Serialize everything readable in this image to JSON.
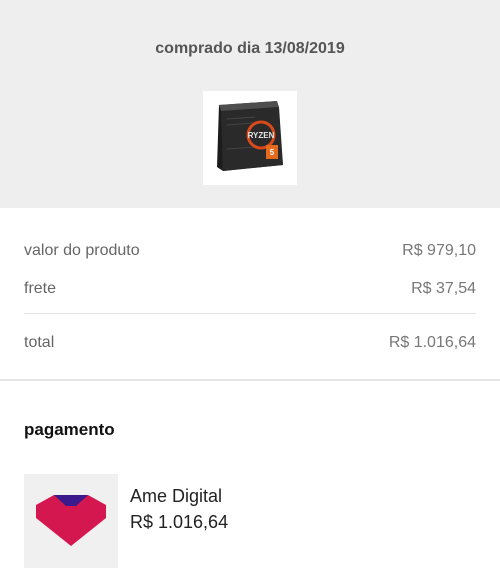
{
  "header": {
    "purchase_date": "comprado dia 13/08/2019"
  },
  "product": {
    "image_icon": "cpu-box-image",
    "brand_text": "RYZEN"
  },
  "summary": {
    "product_label": "valor do produto",
    "product_value": "R$ 979,10",
    "shipping_label": "frete",
    "shipping_value": "R$ 37,54",
    "total_label": "total",
    "total_value": "R$ 1.016,64"
  },
  "payment": {
    "title": "pagamento",
    "method_name": "Ame Digital",
    "method_amount": "R$ 1.016,64",
    "logo_icon": "ame-heart-logo",
    "logo_color": "#d5174f",
    "logo_accent": "#3b1a8c"
  }
}
